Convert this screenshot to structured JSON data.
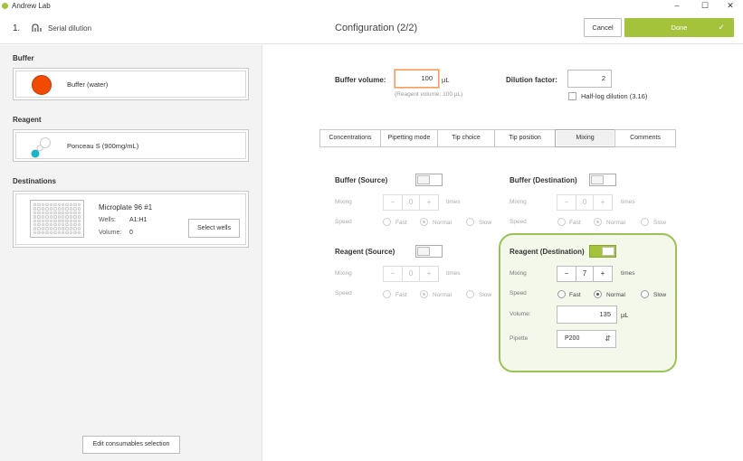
{
  "window": {
    "app_title": "Andrew Lab",
    "min": "–",
    "max": "☐",
    "close": "✕"
  },
  "header": {
    "step_number": "1.",
    "step_name": "Serial dilution",
    "config_title": "Configuration (2/2)",
    "cancel_label": "Cancel",
    "done_label": "Done"
  },
  "left": {
    "buffer_title": "Buffer",
    "buffer_name": "Buffer (water)",
    "buffer_color": "#f24a00",
    "reagent_title": "Reagent",
    "reagent_name": "Ponceau S (900mg/mL)",
    "reagent_color": "#1ab3c8",
    "destinations_title": "Destinations",
    "plate_name": "Microplate 96 #1",
    "wells_label": "Wells:",
    "wells_value": "A1:H1",
    "volume_label": "Volume:",
    "volume_value": "0",
    "select_wells_label": "Select wells",
    "edit_consumables_label": "Edit consumables selection"
  },
  "right": {
    "buffer_volume_label": "Buffer volume:",
    "buffer_volume_value": "100",
    "buffer_volume_unit": "µL",
    "reagent_volume_hint": "(Reagent volume: 100 µL)",
    "dilution_factor_label": "Dilution factor:",
    "dilution_factor_value": "2",
    "half_log_label": "Half-log dilution (3.16)",
    "tabs": [
      "Concentrations",
      "Pipetting mode",
      "Tip choice",
      "Tip position",
      "Mixing",
      "Comments"
    ],
    "active_tab": "Mixing",
    "mixing": {
      "mixing_label": "Mixing",
      "speed_label": "Speed",
      "times_label": "times",
      "fast_label": "Fast",
      "normal_label": "Normal",
      "slow_label": "Slow",
      "minus": "−",
      "plus": "+",
      "buffer_source": {
        "title": "Buffer (Source)",
        "enabled": false,
        "times": "0",
        "speed": "Normal"
      },
      "buffer_destination": {
        "title": "Buffer (Destination)",
        "enabled": false,
        "times": "0",
        "speed": "Normal"
      },
      "reagent_source": {
        "title": "Reagent (Source)",
        "enabled": false,
        "times": "0",
        "speed": "Normal"
      },
      "reagent_destination": {
        "title": "Reagent (Destination)",
        "enabled": true,
        "times": "7",
        "speed": "Normal",
        "volume_label": "Volume:",
        "volume_value": "135",
        "volume_unit": "µL",
        "pipette_label": "Pipette",
        "pipette_value": "P200"
      }
    }
  },
  "colors": {
    "accent": "#a4c23a",
    "highlight_border": "#9ac254",
    "active_input_border": "#f59d5a"
  }
}
